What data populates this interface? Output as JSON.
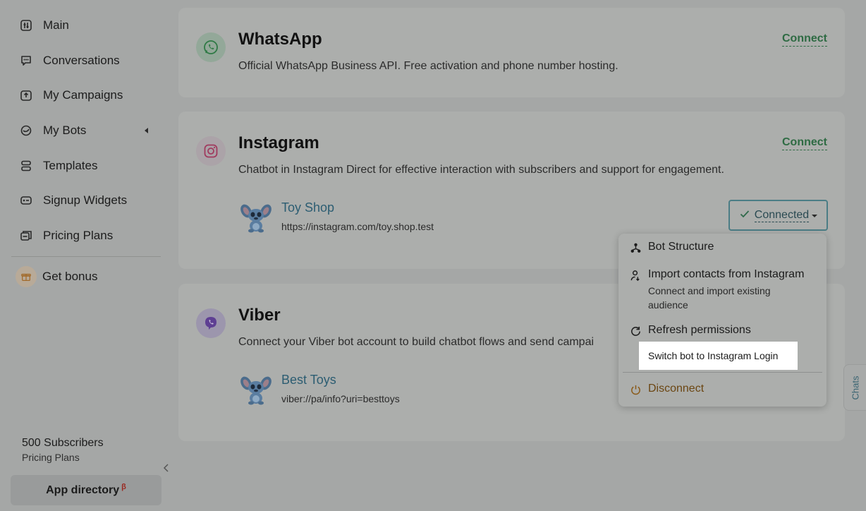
{
  "sidebar": {
    "items": [
      {
        "label": "Main",
        "icon": "dashboard-icon"
      },
      {
        "label": "Conversations",
        "icon": "chat-bubble-icon"
      },
      {
        "label": "My Campaigns",
        "icon": "campaign-upload-icon"
      },
      {
        "label": "My Bots",
        "icon": "bot-icon"
      },
      {
        "label": "Templates",
        "icon": "templates-icon"
      },
      {
        "label": "Signup Widgets",
        "icon": "widget-icon"
      },
      {
        "label": "Pricing Plans",
        "icon": "pricing-icon"
      }
    ],
    "bonus_label": "Get bonus",
    "subscribers": "500 Subscribers",
    "subscribers_sub": "Pricing Plans",
    "app_directory": "App directory",
    "app_directory_badge": "β"
  },
  "channels": {
    "whatsapp": {
      "title": "WhatsApp",
      "description": "Official WhatsApp Business API. Free activation and phone number hosting.",
      "connect_label": "Connect"
    },
    "instagram": {
      "title": "Instagram",
      "description": "Chatbot in Instagram Direct for effective interaction with subscribers and support for engagement.",
      "connect_label": "Connect",
      "account": {
        "name": "Toy Shop",
        "url": "https://instagram.com/toy.shop.test"
      },
      "status_label": "Connected"
    },
    "viber": {
      "title": "Viber",
      "description": "Connect your Viber bot account to build chatbot flows and send campai",
      "account": {
        "name": "Best Toys",
        "url": "viber://pa/info?uri=besttoys"
      }
    }
  },
  "menu": {
    "bot_structure": "Bot Structure",
    "import_contacts": "Import contacts from Instagram",
    "import_contacts_sub": "Connect and import existing audience",
    "refresh_permissions": "Refresh permissions",
    "switch_bot": "Switch bot to Instagram Login",
    "disconnect": "Disconnect"
  },
  "chats_tab": "Chats",
  "colors": {
    "connect_green": "#2e6b43",
    "account_link": "#2c5d72",
    "disconnect": "#6b4612",
    "overlay_bg": "#a5a7a6"
  }
}
